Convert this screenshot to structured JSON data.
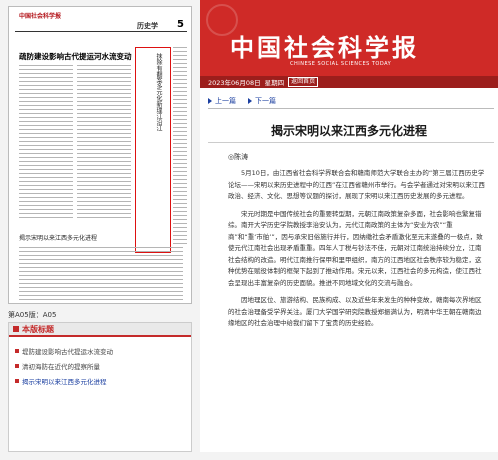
{
  "thumbnail": {
    "masthead": "中国社会科学报",
    "section": "历史学",
    "page_no": "5",
    "headline": "疏防建设影响古代提运河水流变动",
    "second_headline": "揭示宋明以来江西多元化进程",
    "article_vertical_title": "抹除有翻案多元化新理江沿江"
  },
  "edition_label": "第A05版：A05",
  "panel": {
    "title": "本版标题",
    "items": [
      {
        "label": "堤防建设影响古代提运水流变动",
        "selected": false
      },
      {
        "label": "清初海防在近代的提察所量",
        "selected": false
      },
      {
        "label": "揭示宋明以来江西多元化进程",
        "selected": true
      }
    ]
  },
  "masthead": {
    "logo_cn": "中国社会科学报",
    "logo_en": "CHINESE  SOCIAL  SCIENCES  TODAY"
  },
  "datebar": {
    "date": "2023年06月08日",
    "weekday": "星期四",
    "back_button": "返回首页"
  },
  "nav": {
    "prev": "上一篇",
    "next": "下一篇"
  },
  "article": {
    "title": "揭示宋明以来江西多元化进程",
    "author": "◎陈涛",
    "paragraphs": [
      "5月10日，由江西省社会科学界联合会和赣南师范大学联合主办的“第三届江西历史学论坛——宋明以来历史进程中的江西”在江西省赣州市举行。与会学者通过对宋明以来江西政治、经济、文化、思想等议题的探讨，展现了宋明以来江西历史发展的多元进程。",
      "宋元时期是中国传统社会的重要转型期，元朝江南政策复杂多面，社会影响也繁复错综。南开大学历史学院教授李治安认为，元代江南政策的主体为“安业为农”“重商”和“重‘市舶’”，因与承宋旧俗施行并行，因纳缴社会矛盾激化至元末遂叠的一极点，致使元代江南社会出现矛盾重重。四年人丁税与钞法不佳，元朝对江南统治持续分立，江南社会结构的改造。明代江南推行保甲和里甲组织，南方的江西地区社会秩序较为稳定，这种优势在赋役体制的框架下起到了推动作用。宋元以来，江西社会的多元构造，使江西社会呈现出丰富复杂的历史面貌。推进不同地域文化的交流与融合。",
      "因地理区位、旅游结构、民族构成、以及近些年来发生的种种变故，赣南每次界地区的社会治理备受学界关注。厦门大学国学研究院教授郑振满认为，明清中华王朝在赣南边缘地区的社会治理中给我们留下了宝贵的历史经验。"
    ]
  }
}
